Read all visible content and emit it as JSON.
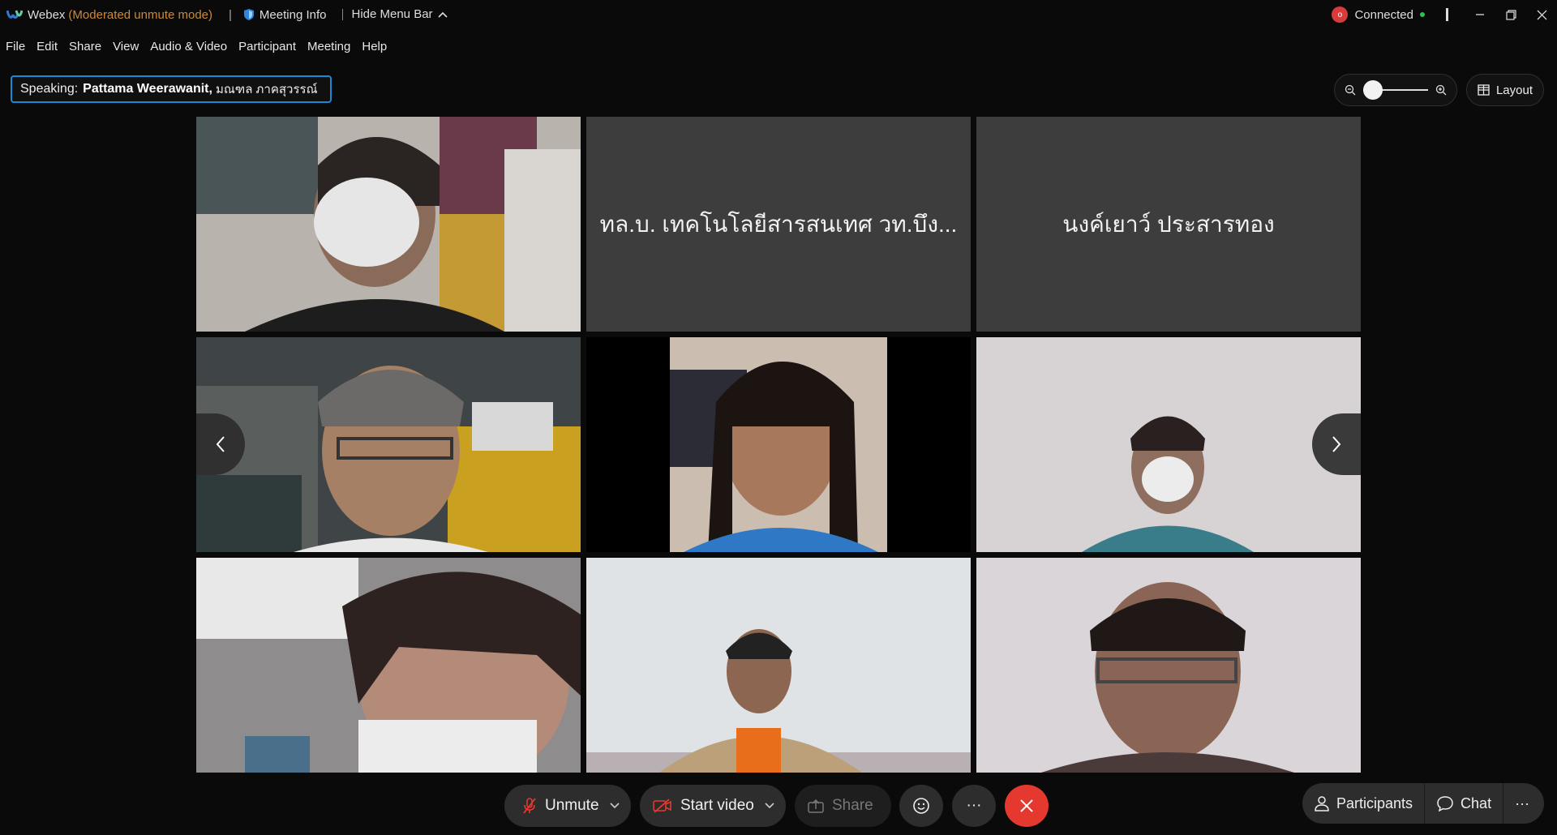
{
  "titlebar": {
    "app_name": "Webex",
    "mode": "(Moderated unmute mode)",
    "separator": "|",
    "meeting_info": "Meeting Info",
    "hide_menu": "Hide Menu Bar",
    "connection_status": "Connected",
    "connection_badge": "o",
    "colors": {
      "mode": "#c98a3a",
      "connection_dot": "#d93a3a",
      "connected": "#2fbf55"
    }
  },
  "menubar": {
    "items": [
      "File",
      "Edit",
      "Share",
      "View",
      "Audio & Video",
      "Participant",
      "Meeting",
      "Help"
    ]
  },
  "speaking": {
    "label": "Speaking:",
    "name": "Pattama Weerawanit,",
    "org": "มณฑล ภาคสุวรรณ์"
  },
  "toolbar": {
    "layout_label": "Layout",
    "zoom_level": 0.05
  },
  "video_grid": {
    "tiles": [
      {
        "type": "video",
        "name": ""
      },
      {
        "type": "name",
        "name": "ทล.บ. เทคโนโลยีสารสนเทศ วท.บึง..."
      },
      {
        "type": "name",
        "name": "นงค์เยาว์ ประสารทอง"
      },
      {
        "type": "video",
        "name": ""
      },
      {
        "type": "video",
        "name": ""
      },
      {
        "type": "video",
        "name": ""
      },
      {
        "type": "video",
        "name": ""
      },
      {
        "type": "video",
        "name": ""
      },
      {
        "type": "video",
        "name": ""
      }
    ]
  },
  "controls": {
    "unmute": "Unmute",
    "start_video": "Start video",
    "share": "Share",
    "participants": "Participants",
    "chat": "Chat",
    "more": "···",
    "colors": {
      "leave": "#e5392f",
      "mic_muted": "#e5392f"
    }
  }
}
